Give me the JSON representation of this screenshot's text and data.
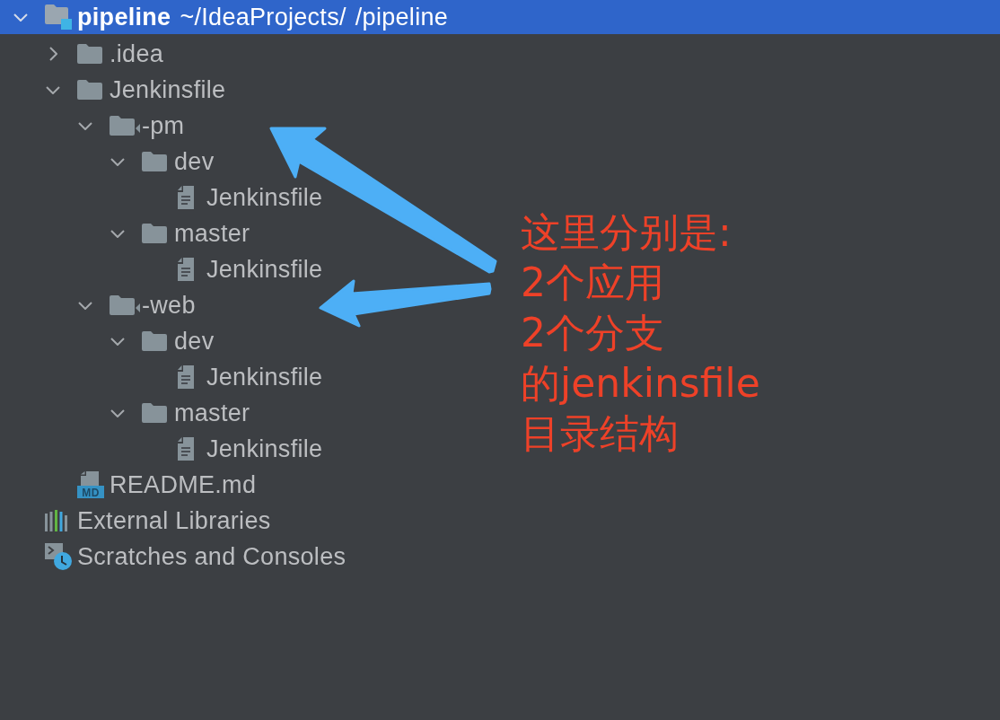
{
  "project_tree": {
    "items": [
      {
        "kind": "module",
        "name": "pipeline",
        "path": [
          "~/IdeaProjects/",
          "/pipeline"
        ],
        "expanded": true,
        "selected": true,
        "children": [
          {
            "kind": "folder",
            "name": ".idea",
            "expanded": false,
            "selected": false
          },
          {
            "kind": "folder",
            "name": "Jenkinsfile",
            "expanded": true,
            "selected": false,
            "children": [
              {
                "kind": "module-folder",
                "name": "-pm",
                "expanded": true,
                "selected": false,
                "children": [
                  {
                    "kind": "folder",
                    "name": "dev",
                    "expanded": true,
                    "selected": false,
                    "children": [
                      {
                        "kind": "file",
                        "name": "Jenkinsfile",
                        "selected": false
                      }
                    ]
                  },
                  {
                    "kind": "folder",
                    "name": "master",
                    "expanded": true,
                    "selected": false,
                    "children": [
                      {
                        "kind": "file",
                        "name": "Jenkinsfile",
                        "selected": false
                      }
                    ]
                  }
                ]
              },
              {
                "kind": "module-folder",
                "name": "-web",
                "expanded": true,
                "selected": false,
                "children": [
                  {
                    "kind": "folder",
                    "name": "dev",
                    "expanded": true,
                    "selected": false,
                    "children": [
                      {
                        "kind": "file",
                        "name": "Jenkinsfile",
                        "selected": false
                      }
                    ]
                  },
                  {
                    "kind": "folder",
                    "name": "master",
                    "expanded": true,
                    "selected": false,
                    "children": [
                      {
                        "kind": "file",
                        "name": "Jenkinsfile",
                        "selected": false
                      }
                    ]
                  }
                ]
              }
            ]
          },
          {
            "kind": "markdown",
            "name": "README.md",
            "icon_text": "MD",
            "selected": false
          }
        ]
      },
      {
        "kind": "libraries",
        "name": "External Libraries",
        "selected": false
      },
      {
        "kind": "scratches",
        "name": "Scratches and Consoles",
        "selected": false
      }
    ]
  },
  "annotation": {
    "lines": [
      "这里分别是:",
      "2个应用",
      "2个分支",
      "的jenkinsfile",
      "目录结构"
    ]
  }
}
